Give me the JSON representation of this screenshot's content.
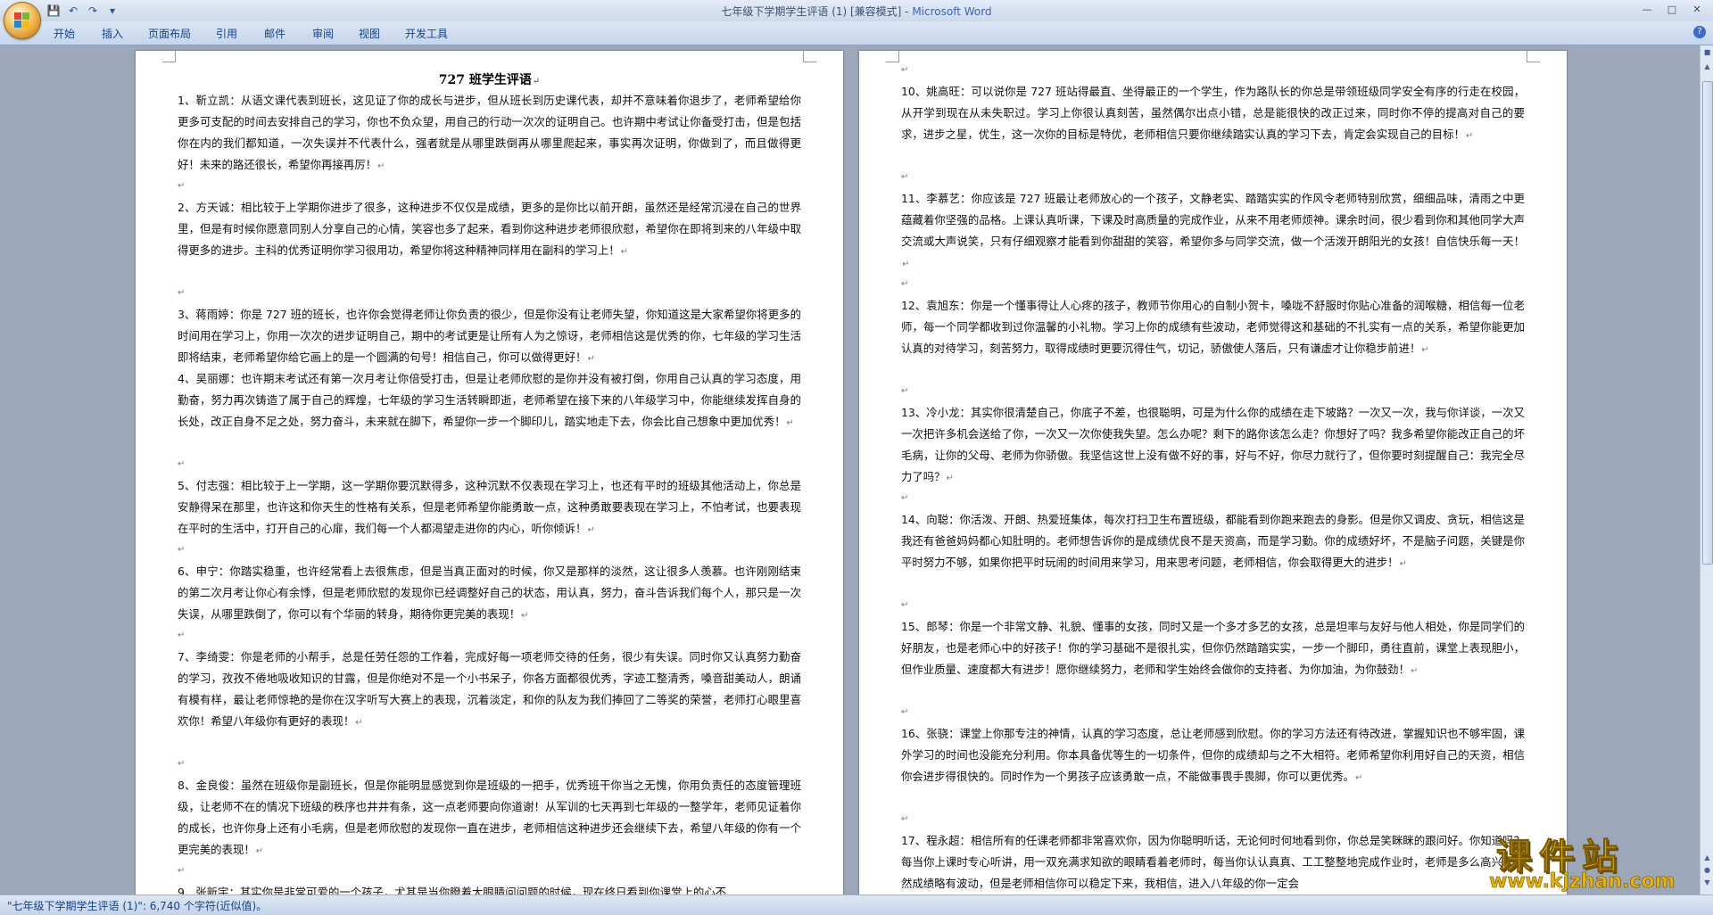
{
  "window": {
    "title_doc": "七年级下学期学生评语 (1) [兼容模式] - ",
    "title_app": "Microsoft Word"
  },
  "qat": [
    "save-icon",
    "undo-icon",
    "redo-icon",
    "customize-icon"
  ],
  "ribbon_tabs": [
    "开始",
    "插入",
    "页面布局",
    "引用",
    "邮件",
    "审阅",
    "视图",
    "开发工具"
  ],
  "doc_heading": "727 班学生评语",
  "page1_paragraphs": [
    "1、靳立凯：从语文课代表到班长，这见证了你的成长与进步，但从班长到历史课代表，却并不意味着你退步了，老师希望给你更多可支配的时间去安排自己的学习，你也不负众望，用自己的行动一次次的证明自己。也许期中考试让你备受打击，但是包括你在内的我们都知道，一次失误并不代表什么，强者就是从哪里跌倒再从哪里爬起来，事实再次证明，你做到了，而且做得更好！未来的路还很长，希望你再接再厉！",
    "2、方天诚：相比较于上学期你进步了很多，这种进步不仅仅是成绩，更多的是你比以前开朗，虽然还是经常沉浸在自己的世界里，但是有时候你愿意同别人分享自己的心情，笑容也多了起来，看到你这种进步老师很欣慰，希望你在即将到来的八年级中取得更多的进步。主科的优秀证明你学习很用功，希望你将这种精神同样用在副科的学习上！",
    "3、蒋雨婷：你是 727 班的班长，也许你会觉得老师让你负责的很少，但是你没有让老师失望，你知道这是大家希望你将更多的时间用在学习上，你用一次次的进步证明自己，期中的考试更是让所有人为之惊讶，老师相信这是优秀的你，七年级的学习生活即将结束，老师希望你给它画上的是一个圆满的句号！相信自己，你可以做得更好！",
    "4、吴丽娜：也许期末考试还有第一次月考让你倍受打击，但是让老师欣慰的是你并没有被打倒，你用自己认真的学习态度，用勤奋，努力再次铸造了属于自己的辉煌，七年级的学习生活转瞬即逝，老师希望在接下来的八年级学习中，你能继续发挥自身的长处，改正自身不足之处，努力奋斗，未来就在脚下，希望你一步一个脚印儿，踏实地走下去，你会比自己想象中更加优秀！",
    "5、付志强：相比较于上一学期，这一学期你要沉默得多，这种沉默不仅表现在学习上，也还有平时的班级其他活动上，你总是安静得呆在那里，也许这和你天生的性格有关系，但是老师希望你能勇敢一点，这种勇敢要表现在学习上，不怕考试，也要表现在平时的生活中，打开自己的心扉，我们每一个人都渴望走进你的内心，听你倾诉！",
    "6、申宁：你踏实稳重，也许经常看上去很焦虑，但是当真正面对的时候，你又是那样的淡然，这让很多人羡慕。也许刚刚结束的第二次月考让你心有余悸，但是老师欣慰的发现你已经调整好自己的状态，用认真，努力，奋斗告诉我们每个人，那只是一次失误，从哪里跌倒了，你可以有个华丽的转身，期待你更完美的表现！",
    "7、李绮雯：你是老师的小帮手，总是任劳任怨的工作着，完成好每一项老师交待的任务，很少有失误。同时你又认真努力勤奋的学习，孜孜不倦地吸收知识的甘露，但是你绝对不是一个小书呆子，你各方面都很优秀，字迹工整清秀，嗓音甜美动人，朗诵有模有样，最让老师惊艳的是你在汉字听写大赛上的表现，沉着淡定，和你的队友为我们捧回了二等奖的荣誉，老师打心眼里喜欢你！希望八年级你有更好的表现！",
    "8、金良俊：虽然在班级你是副班长，但是你能明显感觉到你是班级的一把手，优秀班干你当之无愧，你用负责任的态度管理班级，让老师不在的情况下班级的秩序也井井有条，这一点老师要向你道谢！从军训的七天再到七年级的一整学年，老师见证着你的成长，也许你身上还有小毛病，但是老师欣慰的发现你一直在进步，老师相信这种进步还会继续下去，希望八年级的你有一个更完美的表现！",
    "9、张新宇：其实你是非常可爱的一个孩子，尤其是当你瞪着大眼睛问问题的时候，现在终日看到你课堂上的心不"
  ],
  "page2_paragraphs": [
    "10、姚高旺：可以说你是 727 班站得最直、坐得最正的一个学生，作为路队长的你总是带领班级同学安全有序的行走在校园，从开学到现在从未失职过。学习上你很认真刻苦，虽然偶尔出点小错，总是能很快的改正过来，同时你不停的提高对自己的要求，进步之星，优生，这一次你的目标是特优，老师相信只要你继续踏实认真的学习下去，肯定会实现自己的目标！",
    "11、李慕艺：你应该是 727 班最让老师放心的一个孩子，文静老实、踏踏实实的作风令老师特别欣赏，细细品味，清雨之中更蕴藏着你坚强的品格。上课认真听课，下课及时高质量的完成作业，从来不用老师烦神。课余时间，很少看到你和其他同学大声交流或大声说笑，只有仔细观察才能看到你甜甜的笑容，希望你多与同学交流，做一个活泼开朗阳光的女孩！自信快乐每一天！",
    "12、袁旭东：你是一个懂事得让人心疼的孩子，教师节你用心的自制小贺卡，嗓咙不舒服时你贴心准备的润喉糖，相信每一位老师，每一个同学都收到过你温馨的小礼物。学习上你的成绩有些波动，老师觉得这和基础的不扎实有一点的关系，希望你能更加认真的对待学习，刻苦努力，取得成绩时更要沉得住气，切记，骄傲使人落后，只有谦虚才让你稳步前进！",
    "13、冷小龙：其实你很清楚自己，你底子不差，也很聪明，可是为什么你的成绩在走下坡路？一次又一次，我与你详谈，一次又一次把许多机会送给了你，一次又一次你使我失望。怎么办呢？剩下的路你该怎么走？你想好了吗？我多希望你能改正自己的坏毛病，让你的父母、老师为你骄傲。我坚信这世上没有做不好的事，好与不好，你尽力就行了，但你要时刻提醒自己：我完全尽力了吗？",
    "14、向聪：你活泼、开朗、热爱班集体，每次打扫卫生布置班级，都能看到你跑来跑去的身影。但是你又调皮、贪玩，相信这是我还有爸爸妈妈都心知肚明的。老师想告诉你的是成绩优良不是天资高，而是学习勤。你的成绩好坏，不是脑子问题，关键是你平时努力不够，如果你把平时玩闹的时间用来学习，用来思考问题，老师相信，你会取得更大的进步！",
    "15、郎琴：你是一个非常文静、礼貌、懂事的女孩，同时又是一个多才多艺的女孩，总是坦率与友好与他人相处，你是同学们的好朋友，也是老师心中的好孩子！你的学习基础不是很扎实，但你仍然踏踏实实，一步一个脚印，勇往直前，课堂上表现胆小，但作业质量、速度都大有进步！愿你继续努力，老师和学生始终会做你的支持者、为你加油，为你鼓劲！",
    "16、张骁：课堂上你那专注的神情，认真的学习态度，总让老师感到欣慰。你的学习方法还有待改进，掌握知识也不够牢固，课外学习的时间也没能充分利用。你本具备优等生的一切条件，但你的成绩却与之不大相符。老师希望你利用好自己的天资，相信你会进步得很快的。同时作为一个男孩子应该勇敢一点，不能做事畏手畏脚，你可以更优秀。",
    "17、程永超：相信所有的任课老师都非常喜欢你，因为你聪明听话，无论何时何地看到你，你总是笑眯眯的跟问好。你知道吗？每当你上课时专心听讲，用一双充满求知欲的眼睛看着老师时，每当你认认真真、工工整整地完成作业时，老师是多么高兴。虽然成绩略有波动，但是老师相信你可以稳定下来，我相信，进入八年级的你一定会"
  ],
  "statusbar": {
    "text": "\"七年级下学期学生评语 (1)\": 6,740 个字符(近似值)。"
  },
  "watermark": {
    "cn": "课件站",
    "url": "www.kjzhan.com"
  }
}
